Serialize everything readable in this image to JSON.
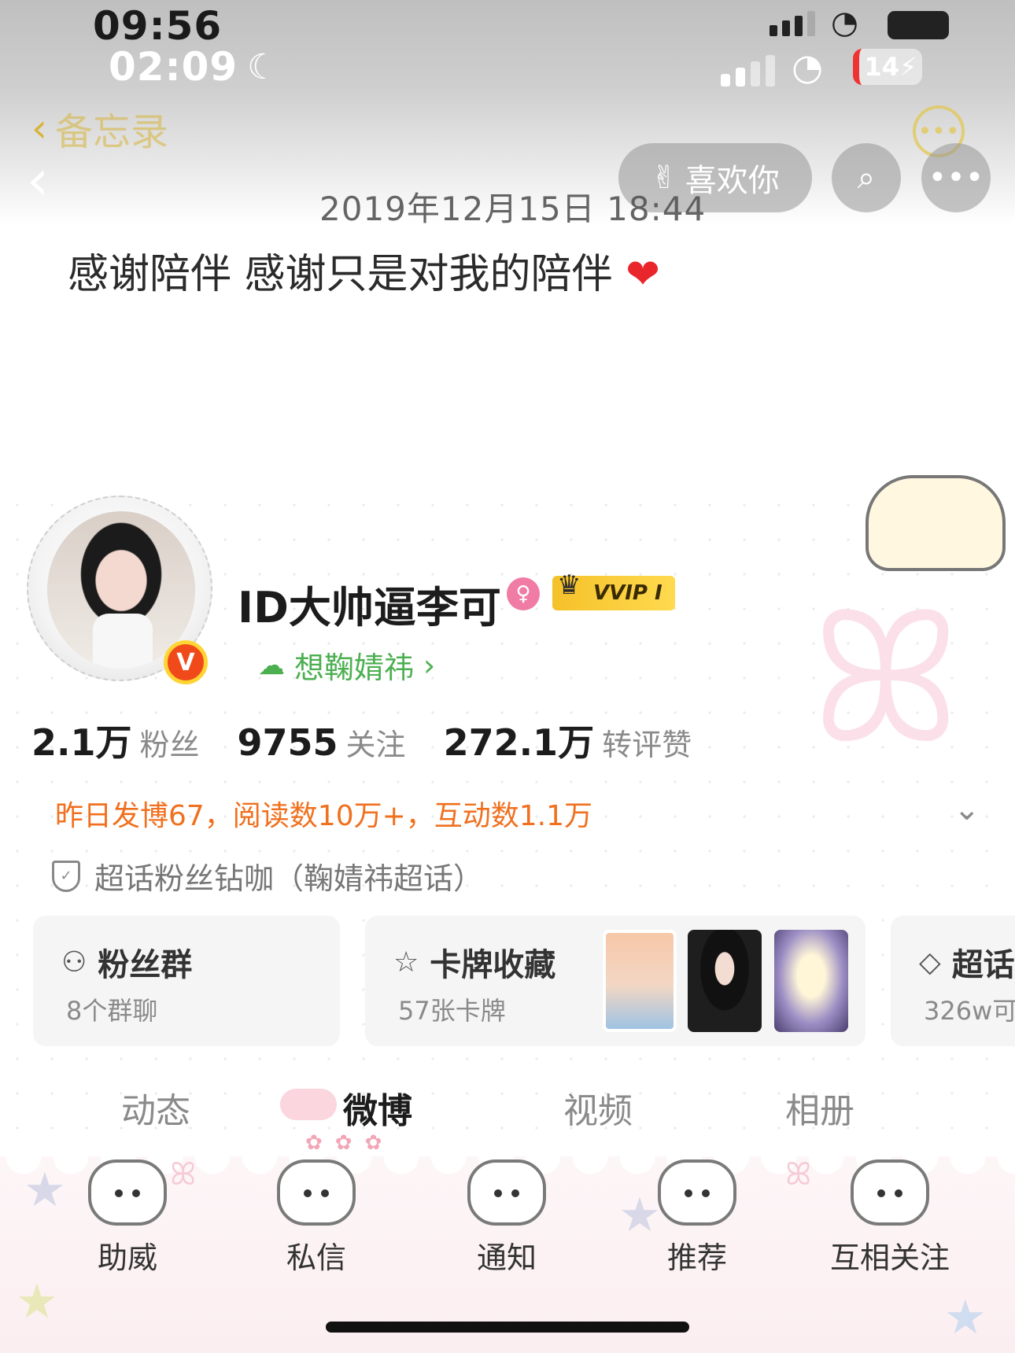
{
  "status_bar": {
    "time_top": "09:56",
    "time_overlay": "02:09",
    "battery": "14"
  },
  "memo_header": {
    "back_label": "备忘录",
    "date": "2019年12月15日 18:44"
  },
  "overlay_header": {
    "like_label": "喜欢你"
  },
  "memo_text": "感谢陪伴 感谢只是对我的陪伴",
  "profile": {
    "username": "ID大帅逼李可",
    "vvip_label": "VVIP I",
    "vbadge": "V",
    "topic_link": "想鞠婧祎",
    "stats": [
      {
        "value": "2.1万",
        "label": "粉丝"
      },
      {
        "value": "9755",
        "label": "关注"
      },
      {
        "value": "272.1万",
        "label": "转评赞"
      }
    ],
    "activity_summary": "昨日发博67，阅读数10万+，互动数1.1万",
    "fan_title": "超话粉丝钻咖（鞠婧祎超话）"
  },
  "cards": [
    {
      "title": "粉丝群",
      "subtitle": "8个群聊"
    },
    {
      "title": "卡牌收藏",
      "subtitle": "57张卡牌"
    },
    {
      "title": "超话",
      "subtitle": "326w可"
    }
  ],
  "tabs": [
    {
      "label": "动态"
    },
    {
      "label": "微博",
      "active": true
    },
    {
      "label": "视频"
    },
    {
      "label": "相册"
    }
  ],
  "bottom_nav": [
    {
      "label": "助威"
    },
    {
      "label": "私信"
    },
    {
      "label": "通知"
    },
    {
      "label": "推荐"
    },
    {
      "label": "互相关注"
    }
  ],
  "colors": {
    "accent_orange": "#f0701e",
    "topic_green": "#4caf50",
    "vvip_gold": "#f5c12a",
    "memo_gold": "#d7b43a"
  }
}
